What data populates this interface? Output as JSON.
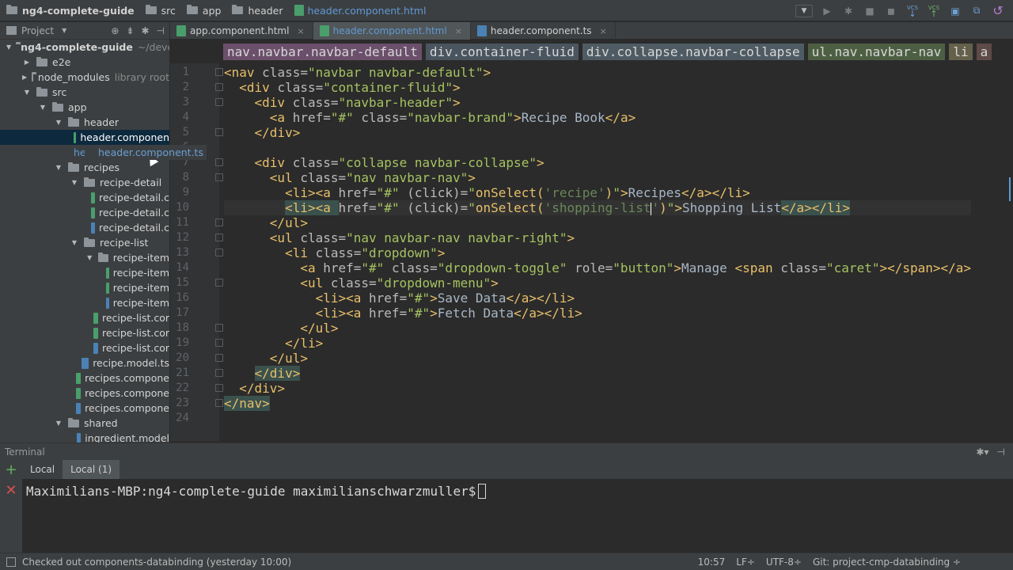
{
  "nav": {
    "crumbs": [
      "ng4-complete-guide",
      "src",
      "app",
      "header",
      "header.component.html"
    ]
  },
  "project": {
    "label": "Project",
    "tree": [
      {
        "label": "ng4-complete-guide",
        "extra": "~/devel",
        "depth": 0,
        "arrow": "▼",
        "kind": "folder",
        "bold": true
      },
      {
        "label": "e2e",
        "depth": 1,
        "arrow": "▶",
        "kind": "folder"
      },
      {
        "label": "node_modules",
        "extra": "library root",
        "depth": 1,
        "arrow": "▶",
        "kind": "folder"
      },
      {
        "label": "src",
        "depth": 1,
        "arrow": "▼",
        "kind": "folder"
      },
      {
        "label": "app",
        "depth": 2,
        "arrow": "▼",
        "kind": "folder"
      },
      {
        "label": "header",
        "depth": 3,
        "arrow": "▼",
        "kind": "folder"
      },
      {
        "label": "header.componen",
        "depth": 4,
        "kind": "html",
        "selected": true
      },
      {
        "label": "header.component.ts",
        "depth": 4,
        "kind": "ts",
        "hover": true
      },
      {
        "label": "recipes",
        "depth": 3,
        "arrow": "▼",
        "kind": "folder"
      },
      {
        "label": "recipe-detail",
        "depth": 4,
        "arrow": "▼",
        "kind": "folder"
      },
      {
        "label": "recipe-detail.c",
        "depth": 5,
        "kind": "css"
      },
      {
        "label": "recipe-detail.c",
        "depth": 5,
        "kind": "html"
      },
      {
        "label": "recipe-detail.c",
        "depth": 5,
        "kind": "ts"
      },
      {
        "label": "recipe-list",
        "depth": 4,
        "arrow": "▼",
        "kind": "folder"
      },
      {
        "label": "recipe-item",
        "depth": 5,
        "arrow": "▼",
        "kind": "folder"
      },
      {
        "label": "recipe-item",
        "depth": 6,
        "kind": "css"
      },
      {
        "label": "recipe-item",
        "depth": 6,
        "kind": "html"
      },
      {
        "label": "recipe-item",
        "depth": 6,
        "kind": "ts"
      },
      {
        "label": "recipe-list.cor",
        "depth": 5,
        "kind": "css"
      },
      {
        "label": "recipe-list.cor",
        "depth": 5,
        "kind": "html"
      },
      {
        "label": "recipe-list.cor",
        "depth": 5,
        "kind": "ts"
      },
      {
        "label": "recipe.model.ts",
        "depth": 4,
        "kind": "ts"
      },
      {
        "label": "recipes.compone",
        "depth": 4,
        "kind": "css"
      },
      {
        "label": "recipes.compone",
        "depth": 4,
        "kind": "html"
      },
      {
        "label": "recipes.compone",
        "depth": 4,
        "kind": "ts"
      },
      {
        "label": "shared",
        "depth": 3,
        "arrow": "▼",
        "kind": "folder"
      },
      {
        "label": "ingredient.model",
        "depth": 4,
        "kind": "ts"
      }
    ],
    "tooltip": "header.component.ts"
  },
  "tabs": [
    {
      "label": "app.component.html",
      "kind": "html",
      "active": false
    },
    {
      "label": "header.component.html",
      "kind": "html",
      "active": true
    },
    {
      "label": "header.component.ts",
      "kind": "ts",
      "active": false
    }
  ],
  "chips": [
    "nav.navbar.navbar-default",
    "div.container-fluid",
    "div.collapse.navbar-collapse",
    "ul.nav.navbar-nav",
    "li",
    "a"
  ],
  "editor": {
    "line_numbers": [
      "1",
      "2",
      "3",
      "4",
      "5",
      "6",
      "7",
      "8",
      "9",
      "10",
      "11",
      "12",
      "13",
      "14",
      "15",
      "16",
      "17",
      "18",
      "19",
      "20",
      "21",
      "22",
      "23",
      "24"
    ],
    "lines": [
      [
        [
          "tg",
          "<nav "
        ],
        [
          "at",
          "class="
        ],
        [
          "st",
          "\"navbar navbar-default\""
        ],
        [
          "tg",
          ">"
        ]
      ],
      [
        [
          "pl",
          "  "
        ],
        [
          "tg",
          "<div "
        ],
        [
          "at",
          "class="
        ],
        [
          "st",
          "\"container-fluid\""
        ],
        [
          "tg",
          ">"
        ]
      ],
      [
        [
          "pl",
          "    "
        ],
        [
          "tg",
          "<div "
        ],
        [
          "at",
          "class="
        ],
        [
          "st",
          "\"navbar-header\""
        ],
        [
          "tg",
          ">"
        ]
      ],
      [
        [
          "pl",
          "      "
        ],
        [
          "tg",
          "<a "
        ],
        [
          "at",
          "href="
        ],
        [
          "st",
          "\"#\" "
        ],
        [
          "at",
          "class="
        ],
        [
          "st",
          "\"navbar-brand\""
        ],
        [
          "tg",
          ">"
        ],
        [
          "pl",
          "Recipe Book"
        ],
        [
          "tg",
          "</a>"
        ]
      ],
      [
        [
          "pl",
          "    "
        ],
        [
          "tg",
          "</div>"
        ]
      ],
      [
        [
          "pl",
          ""
        ]
      ],
      [
        [
          "pl",
          "    "
        ],
        [
          "tg",
          "<div "
        ],
        [
          "at",
          "class="
        ],
        [
          "st",
          "\"collapse navbar-collapse\""
        ],
        [
          "tg",
          ">"
        ]
      ],
      [
        [
          "pl",
          "      "
        ],
        [
          "tg",
          "<ul "
        ],
        [
          "at",
          "class="
        ],
        [
          "st",
          "\"nav navbar-nav\""
        ],
        [
          "tg",
          ">"
        ]
      ],
      [
        [
          "pl",
          "        "
        ],
        [
          "tg",
          "<li><a "
        ],
        [
          "at",
          "href="
        ],
        [
          "st",
          "\"#\" "
        ],
        [
          "at",
          "(click)="
        ],
        [
          "st",
          "\""
        ],
        [
          "tg",
          "onSelect("
        ],
        [
          "sq",
          "'recipe'"
        ],
        [
          "tg",
          ")"
        ],
        [
          "st",
          "\""
        ],
        [
          "tg",
          ">"
        ],
        [
          "pl",
          "Recipes"
        ],
        [
          "tg",
          "</a></li>"
        ]
      ],
      [
        [
          "pl",
          "        "
        ],
        [
          "hl",
          "<li><a "
        ],
        [
          "at",
          "href="
        ],
        [
          "st",
          "\"#\" "
        ],
        [
          "at",
          "(click)="
        ],
        [
          "st",
          "\""
        ],
        [
          "tg",
          "onSelect("
        ],
        [
          "sq",
          "'shopping-list"
        ],
        [
          "cur",
          ""
        ],
        [
          "sq",
          "'"
        ],
        [
          "tg",
          ")"
        ],
        [
          "st",
          "\""
        ],
        [
          "tg",
          ">"
        ],
        [
          "pl",
          "Shopping List"
        ],
        [
          "hl",
          "</a></li>"
        ]
      ],
      [
        [
          "pl",
          "      "
        ],
        [
          "tg",
          "</ul>"
        ]
      ],
      [
        [
          "pl",
          "      "
        ],
        [
          "tg",
          "<ul "
        ],
        [
          "at",
          "class="
        ],
        [
          "st",
          "\"nav navbar-nav navbar-right\""
        ],
        [
          "tg",
          ">"
        ]
      ],
      [
        [
          "pl",
          "        "
        ],
        [
          "tg",
          "<li "
        ],
        [
          "at",
          "class="
        ],
        [
          "st",
          "\"dropdown\""
        ],
        [
          "tg",
          ">"
        ]
      ],
      [
        [
          "pl",
          "          "
        ],
        [
          "tg",
          "<a "
        ],
        [
          "at",
          "href="
        ],
        [
          "st",
          "\"#\" "
        ],
        [
          "at",
          "class="
        ],
        [
          "st",
          "\"dropdown-toggle\" "
        ],
        [
          "at",
          "role="
        ],
        [
          "st",
          "\"button\""
        ],
        [
          "tg",
          ">"
        ],
        [
          "pl",
          "Manage "
        ],
        [
          "tg",
          "<span "
        ],
        [
          "at",
          "class="
        ],
        [
          "st",
          "\"caret\""
        ],
        [
          "tg",
          "></span></a>"
        ]
      ],
      [
        [
          "pl",
          "          "
        ],
        [
          "tg",
          "<ul "
        ],
        [
          "at",
          "class="
        ],
        [
          "st",
          "\"dropdown-menu\""
        ],
        [
          "tg",
          ">"
        ]
      ],
      [
        [
          "pl",
          "            "
        ],
        [
          "tg",
          "<li><a "
        ],
        [
          "at",
          "href="
        ],
        [
          "st",
          "\"#\""
        ],
        [
          "tg",
          ">"
        ],
        [
          "pl",
          "Save Data"
        ],
        [
          "tg",
          "</a></li>"
        ]
      ],
      [
        [
          "pl",
          "            "
        ],
        [
          "tg",
          "<li><a "
        ],
        [
          "at",
          "href="
        ],
        [
          "st",
          "\"#\""
        ],
        [
          "tg",
          ">"
        ],
        [
          "pl",
          "Fetch Data"
        ],
        [
          "tg",
          "</a></li>"
        ]
      ],
      [
        [
          "pl",
          "          "
        ],
        [
          "tg",
          "</ul>"
        ]
      ],
      [
        [
          "pl",
          "        "
        ],
        [
          "tg",
          "</li>"
        ]
      ],
      [
        [
          "pl",
          "      "
        ],
        [
          "tg",
          "</ul>"
        ]
      ],
      [
        [
          "pl",
          "    "
        ],
        [
          "hl",
          "</div>"
        ]
      ],
      [
        [
          "pl",
          "  "
        ],
        [
          "tg",
          "</div>"
        ]
      ],
      [
        [
          "hl",
          "</nav>"
        ]
      ],
      [
        [
          "pl",
          ""
        ]
      ]
    ]
  },
  "terminal": {
    "title": "Terminal",
    "tabs": [
      "Local",
      "Local (1)"
    ],
    "prompt": "Maximilians-MBP:ng4-complete-guide maximilianschwarzmuller$"
  },
  "status": {
    "message": "Checked out components-databinding (yesterday 10:00)",
    "position": "10:57",
    "line_sep": "LF÷",
    "encoding": "UTF-8÷",
    "branch": "Git: project-cmp-databinding ÷"
  },
  "colors": {
    "accent": "#5f9ad6",
    "tag": "#e8bf6a",
    "string": "#a5c261",
    "background": "#2b2b2b"
  }
}
